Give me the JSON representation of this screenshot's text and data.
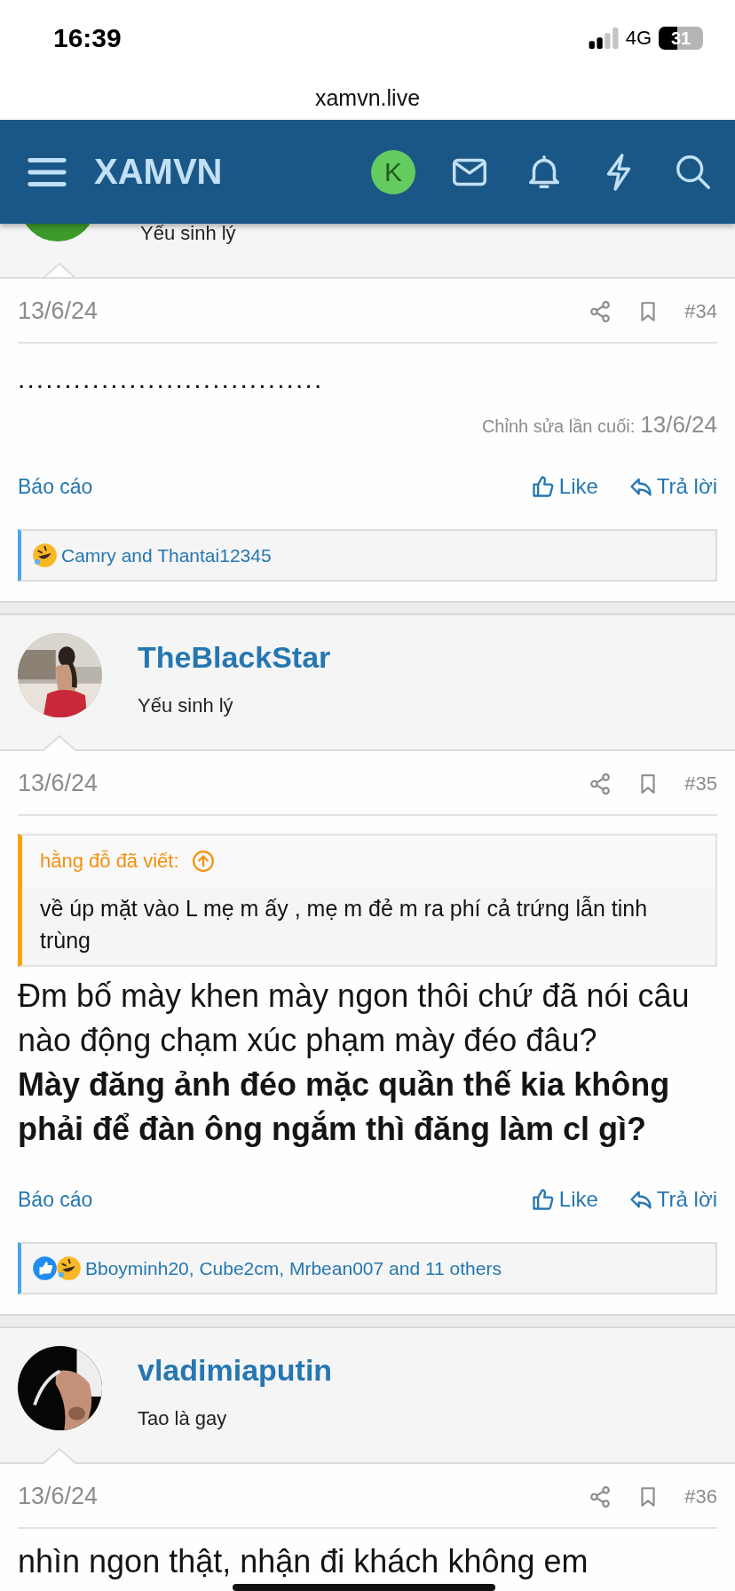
{
  "status_bar": {
    "time": "16:39",
    "network": "4G",
    "battery": "31"
  },
  "browser": {
    "url": "xamvn.live"
  },
  "nav": {
    "logo": "XAMVN",
    "avatar_letter": "K"
  },
  "top_author": {
    "title": "Yếu sinh lý"
  },
  "posts": [
    {
      "date": "13/6/24",
      "number": "#34",
      "body": [
        {
          "kind": "text",
          "text": "................................."
        }
      ],
      "edited": {
        "label": "Chỉnh sửa lần cuối:",
        "date": "13/6/24"
      },
      "actions": {
        "report": "Báo cáo",
        "like": "Like",
        "reply": "Trả lời"
      },
      "reactions": {
        "icons": [
          {
            "kind": "haha"
          }
        ],
        "text": "Camry and Thantai12345"
      }
    },
    {
      "author": {
        "name": "TheBlackStar",
        "title": "Yếu sinh lý"
      },
      "date": "13/6/24",
      "number": "#35",
      "quote": {
        "author": "hằng đỗ đã viết:",
        "text": "về úp mặt vào L mẹ m ấy , mẹ m đẻ m ra phí cả trứng lẫn tinh trùng"
      },
      "body": [
        {
          "kind": "text",
          "text": "Đm bố mày khen mày ngon thôi chứ đã nói câu nào động chạm xúc phạm mày đéo đâu?"
        },
        {
          "kind": "bold",
          "text": "Mày đăng ảnh đéo mặc quần thế kia không phải để đàn ông ngắm thì đăng làm cl gì?"
        }
      ],
      "actions": {
        "report": "Báo cáo",
        "like": "Like",
        "reply": "Trả lời"
      },
      "reactions": {
        "icons": [
          {
            "kind": "like"
          },
          {
            "kind": "haha"
          }
        ],
        "text": "Bboyminh20, Cube2cm, Mrbean007 and 11 others"
      }
    },
    {
      "author": {
        "name": "vladimiaputin",
        "title": "Tao là gay"
      },
      "date": "13/6/24",
      "number": "#36",
      "body": [
        {
          "kind": "text",
          "text": "nhìn ngon thật, nhận đi khách không em"
        }
      ]
    }
  ]
}
